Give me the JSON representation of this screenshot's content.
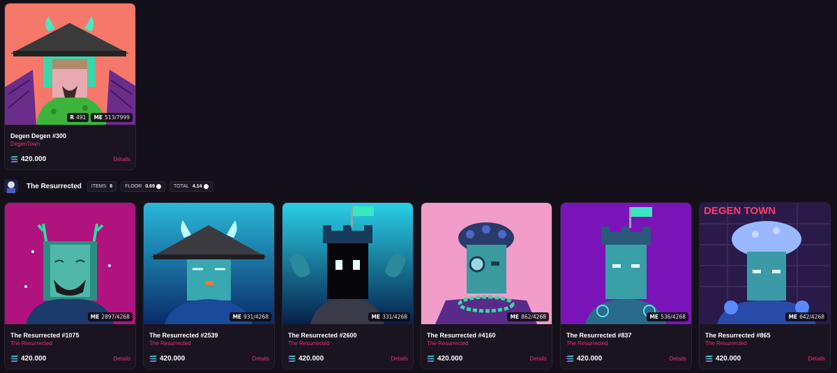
{
  "featured": {
    "name": "Degen Degen #300",
    "collection": "DegenTown",
    "price": "420.000",
    "details_label": "Details",
    "badges": [
      {
        "icon": "R",
        "value": "491"
      },
      {
        "icon": "ME",
        "value": "513/7999"
      }
    ]
  },
  "collection": {
    "title": "The Resurrected",
    "stats": [
      {
        "label": "ITEMS",
        "value": "6"
      },
      {
        "label": "FLOOR",
        "value": "0.69"
      },
      {
        "label": "TOTAL",
        "value": "4.14"
      }
    ]
  },
  "cards": [
    {
      "name": "The Resurrected #1075",
      "collection": "The Resurrected",
      "price": "420.000",
      "details_label": "Details",
      "rank": "2897/4268"
    },
    {
      "name": "The Resurrected #2539",
      "collection": "The Resurrected",
      "price": "420.000",
      "details_label": "Details",
      "rank": "931/4268"
    },
    {
      "name": "The Resurrected #2600",
      "collection": "The Resurrected",
      "price": "420.000",
      "details_label": "Details",
      "rank": "331/4268"
    },
    {
      "name": "The Resurrected #4160",
      "collection": "The Resurrected",
      "price": "420.000",
      "details_label": "Details",
      "rank": "862/4268"
    },
    {
      "name": "The Resurrected #837",
      "collection": "The Resurrected",
      "price": "420.000",
      "details_label": "Details",
      "rank": "536/4268"
    },
    {
      "name": "The Resurrected #865",
      "collection": "The Resurrected",
      "price": "420.000",
      "details_label": "Details",
      "rank": "642/4268"
    }
  ],
  "artwork_texts": {
    "degen_sign": "DEGEN TOWN"
  },
  "colors": {
    "background": "#14101a",
    "accent": "#e8336e",
    "card_border": "#2b2433"
  },
  "icons": {
    "rank_badge": "rarity-rank-icon",
    "me_badge": "magic-eden-icon",
    "price": "solana-icon",
    "floor": "sol-coin-icon"
  }
}
